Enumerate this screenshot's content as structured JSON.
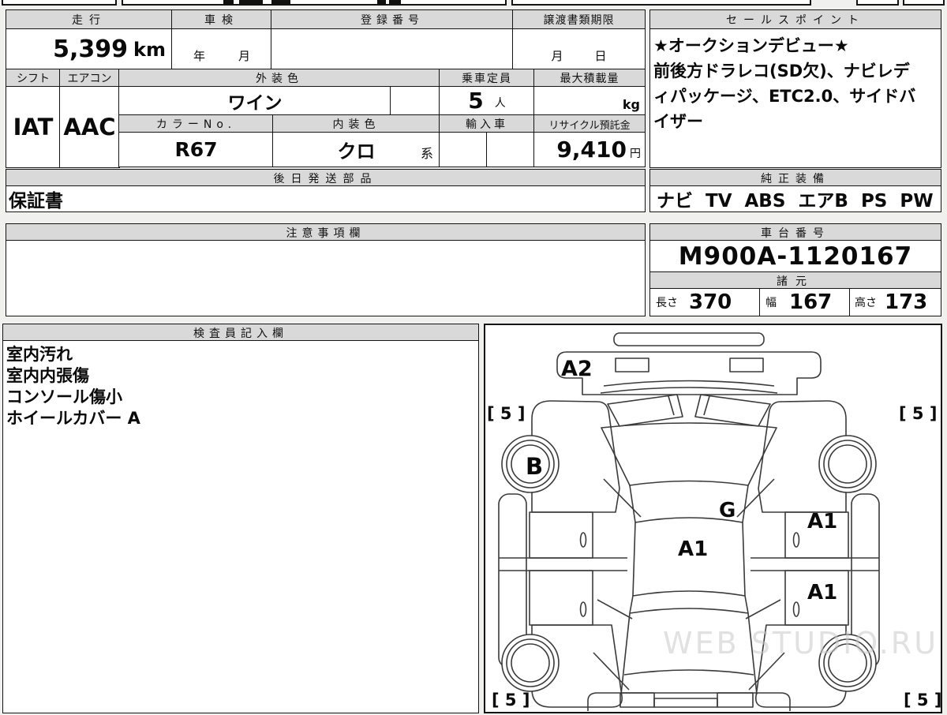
{
  "colors": {
    "header_bg": "#d9d9d9",
    "border": "#141414",
    "page_bg": "#f0f0ef",
    "watermark_gray": "#cccccc"
  },
  "spec_table": {
    "mileage_label": "走行",
    "mileage_value": "5,399",
    "mileage_unit": "km",
    "inspection_label": "車検",
    "inspection_year": "年",
    "inspection_month": "月",
    "registration_label": "登録番号",
    "transfer_label": "譲渡書類期限",
    "transfer_month": "月",
    "transfer_day": "日",
    "shift_label": "シフト",
    "shift_value": "IAT",
    "aircon_label": "エアコン",
    "aircon_value": "AAC",
    "exterior_color_label": "外装色",
    "exterior_color_value": "ワイン",
    "capacity_label": "乗車定員",
    "capacity_value": "5",
    "capacity_unit": "人",
    "max_load_label": "最大積載量",
    "max_load_unit": "kg",
    "color_no_label": "カラーNo.",
    "color_no_value": "R67",
    "interior_color_label": "内装色",
    "interior_color_value": "クロ",
    "interior_color_suffix": "系",
    "import_label": "輸入車",
    "recycle_label": "リサイクル預託金",
    "recycle_value": "9,410",
    "recycle_unit": "円",
    "later_parts_label": "後日発送部品",
    "later_parts_value": "保証書"
  },
  "sales_point": {
    "label": "セールスポイント",
    "lines": [
      "★オークションデビュー★",
      "前後方ドラレコ(SD欠)、ナビレデ",
      "ィパッケージ、ETC2.0、サイドバ",
      "イザー"
    ]
  },
  "genuine_equipment": {
    "label": "純正装備",
    "value": "ナビ TV ABS エアB PS PW"
  },
  "caution": {
    "label": "注意事項欄",
    "value": ""
  },
  "chassis": {
    "label": "車台番号",
    "value": "M900A-1120167"
  },
  "dimensions": {
    "label": "諸元",
    "length_label": "長さ",
    "length_value": "370",
    "width_label": "幅",
    "width_value": "167",
    "height_label": "高さ",
    "height_value": "173"
  },
  "inspector": {
    "label": "検査員記入欄",
    "lines": [
      "室内汚れ",
      "室内内張傷",
      "コンソール傷小",
      "ホイールカバー A"
    ]
  },
  "diagram": {
    "front_bumper_mark": "A2",
    "corner_top_left": "[ 5 ]",
    "corner_top_right": "[ 5 ]",
    "corner_bottom_left": "[ 5 ]",
    "corner_bottom_right": "[ 5 ]",
    "front_left_wheel_mark": "B",
    "cowl_mark": "G",
    "roof_mark": "A1",
    "front_right_door_mark": "A1",
    "rear_right_door_mark": "A1",
    "watermark": "WEB STUDIO.RU"
  }
}
